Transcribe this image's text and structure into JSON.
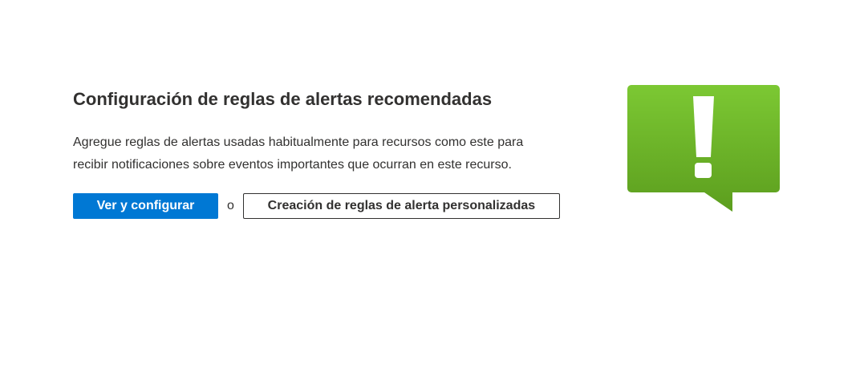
{
  "title": "Configuración de reglas de alertas recomendadas",
  "description": "Agregue reglas de alertas usadas habitualmente para recursos como este para recibir notificaciones sobre eventos importantes que ocurran en este recurso.",
  "actions": {
    "primary_label": "Ver y configurar",
    "separator": "o",
    "secondary_label": "Creación de reglas de alerta personalizadas"
  },
  "illustration": {
    "icon": "alert-exclamation-speech-bubble-icon",
    "color_top": "#7cc833",
    "color_bottom": "#5c9e1e"
  },
  "colors": {
    "primary_button": "#0078d4",
    "text": "#323130"
  }
}
